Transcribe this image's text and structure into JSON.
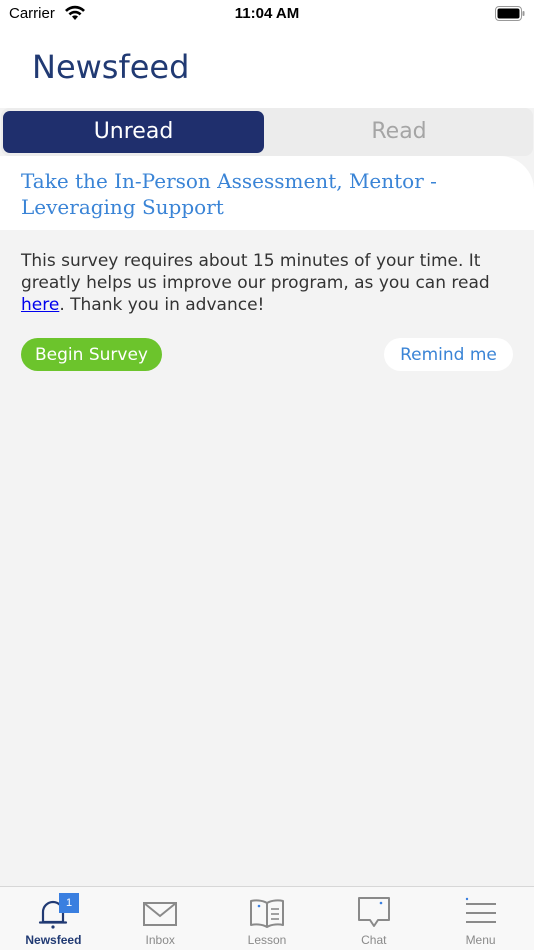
{
  "status_bar": {
    "carrier": "Carrier",
    "time": "11:04 AM"
  },
  "header": {
    "title": "Newsfeed"
  },
  "segments": {
    "unread": "Unread",
    "read": "Read",
    "selected": "Unread"
  },
  "survey": {
    "title": "Take the In-Person Assessment, Mentor - Leveraging Support",
    "body_before": "This survey requires about 15 minutes of your time. It greatly helps us improve our program, as you can read ",
    "link_text": "here",
    "body_after": ". Thank you in advance!",
    "begin_label": "Begin Survey",
    "remind_label": "Remind me"
  },
  "tabs": [
    {
      "label": "Newsfeed",
      "icon": "bell-icon",
      "badge": "1",
      "active": true
    },
    {
      "label": "Inbox",
      "icon": "envelope-icon"
    },
    {
      "label": "Lesson",
      "icon": "book-icon"
    },
    {
      "label": "Chat",
      "icon": "chat-bubble-icon"
    },
    {
      "label": "Menu",
      "icon": "hamburger-icon"
    }
  ],
  "colors": {
    "brand_navy": "#213a73",
    "segment_active": "#1f2f6d",
    "link_blue": "#3a84d6",
    "begin_green": "#6cc42c",
    "badge_blue": "#3a7fe0"
  }
}
